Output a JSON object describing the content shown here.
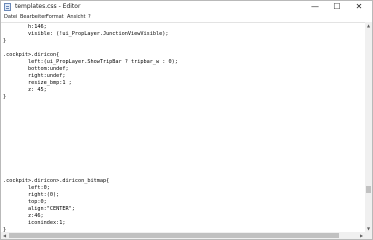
{
  "window": {
    "title": "templates.css - Editor",
    "icon": "notepad-icon",
    "controls": {
      "minimize": "—",
      "maximize": "☐",
      "close": "✕"
    }
  },
  "menu": {
    "items": [
      "Datei",
      "Bearbeiten",
      "Format",
      "Ansicht",
      "?"
    ]
  },
  "editor": {
    "lines": [
      "        h:146;",
      "        visible: (!ui_PropLayer.JunctionViewVisible);",
      "}",
      "",
      ".cockpit>.diricon{",
      "        left:(ui_PropLayer.ShowTripBar ? tripbar_w : 0);",
      "        bottom:undef;",
      "        right:undef;",
      "        resize_bmp:1 ;",
      "        z: 45;",
      "}",
      "",
      "",
      "",
      "",
      "",
      "",
      "",
      "",
      "",
      "",
      "",
      ".cockpit>.diricon>.diricon_bitmap{",
      "        left:0;",
      "        right:(0);",
      "        top:0;",
      "        align:\"CENTER\";",
      "        z:46;",
      "        iconindex:1;",
      "}"
    ]
  }
}
